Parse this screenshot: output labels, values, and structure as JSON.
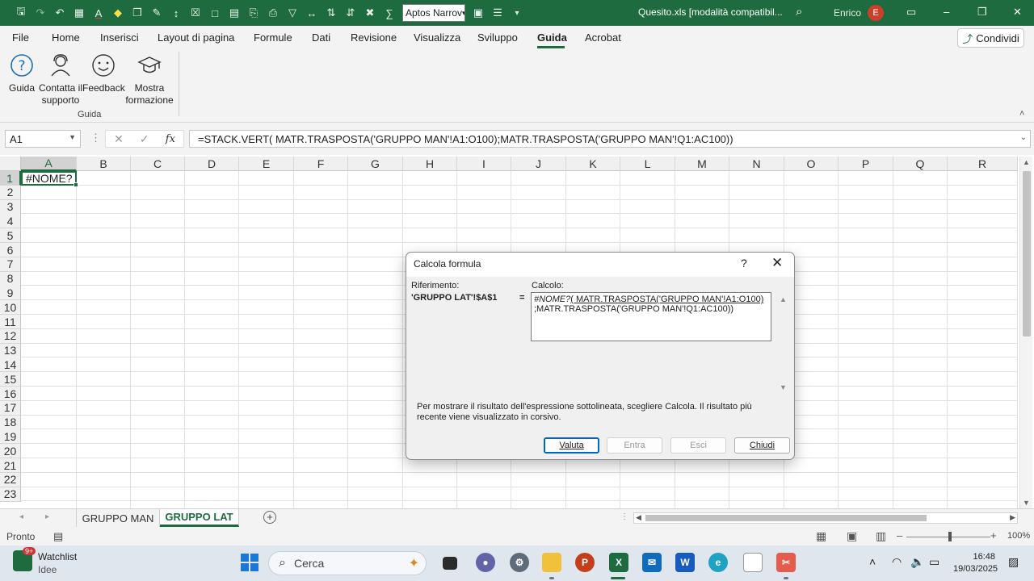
{
  "app": {
    "filename": "Quesito.xls  [modalità compatibil...",
    "user": "Enrico",
    "avatar_letter": "E",
    "font_name": "Aptos Narrov",
    "accent_color": "#1d6b3e"
  },
  "menu": {
    "tabs": [
      "File",
      "Home",
      "Inserisci",
      "Layout di pagina",
      "Formule",
      "Dati",
      "Revisione",
      "Visualizza",
      "Sviluppo",
      "Guida",
      "Acrobat"
    ],
    "active_tab": "Guida",
    "share_label": "Condividi"
  },
  "ribbon": {
    "buttons": [
      {
        "label": "Guida",
        "icon": "help-icon"
      },
      {
        "label": "Contatta il supporto",
        "icon": "support-icon"
      },
      {
        "label": "Feedback",
        "icon": "feedback-icon"
      },
      {
        "label": "Mostra formazione",
        "icon": "training-icon"
      }
    ],
    "group_label": "Guida"
  },
  "formula_bar": {
    "name_box": "A1",
    "formula": "=STACK.VERT( MATR.TRASPOSTA('GRUPPO MAN'!A1:O100);MATR.TRASPOSTA('GRUPPO MAN'!Q1:AC100))"
  },
  "grid": {
    "columns": [
      "A",
      "B",
      "C",
      "D",
      "E",
      "F",
      "G",
      "H",
      "I",
      "J",
      "K",
      "L",
      "M",
      "N",
      "O",
      "P",
      "Q",
      "R"
    ],
    "rows": [
      "1",
      "2",
      "3",
      "4",
      "5",
      "6",
      "7",
      "8",
      "9",
      "10",
      "11",
      "12",
      "13",
      "14",
      "15",
      "16",
      "17",
      "18",
      "19",
      "20",
      "21",
      "22",
      "23"
    ],
    "selected_cell": "A1",
    "a1_value": "#NOME?"
  },
  "sheets": {
    "tabs": [
      "GRUPPO MAN",
      "GRUPPO LAT"
    ],
    "active": "GRUPPO LAT"
  },
  "status": {
    "ready": "Pronto",
    "zoom": "100%"
  },
  "dialog": {
    "title": "Calcola formula",
    "help": "?",
    "reference_label": "Riferimento:",
    "reference_value": "'GRUPPO LAT'!$A$1",
    "equals": "=",
    "calc_label": "Calcolo:",
    "calc_error": "#NOME?",
    "calc_underlined": "( MATR.TRASPOSTA('GRUPPO MAN'!A1:O100)",
    "calc_rest": ";MATR.TRASPOSTA('GRUPPO MAN'!Q1:AC100))",
    "hint": "Per mostrare il risultato dell'espressione sottolineata, scegliere Calcola. Il risultato più recente viene visualizzato in corsivo.",
    "buttons": {
      "evaluate": "Valuta",
      "step_in": "Entra",
      "step_out": "Esci",
      "close": "Chiudi"
    }
  },
  "taskbar": {
    "widget_title": "Watchlist",
    "widget_subtitle": "Idee",
    "widget_badge": "9+",
    "search_label": "Cerca",
    "time": "16:48",
    "date": "19/03/2025"
  }
}
